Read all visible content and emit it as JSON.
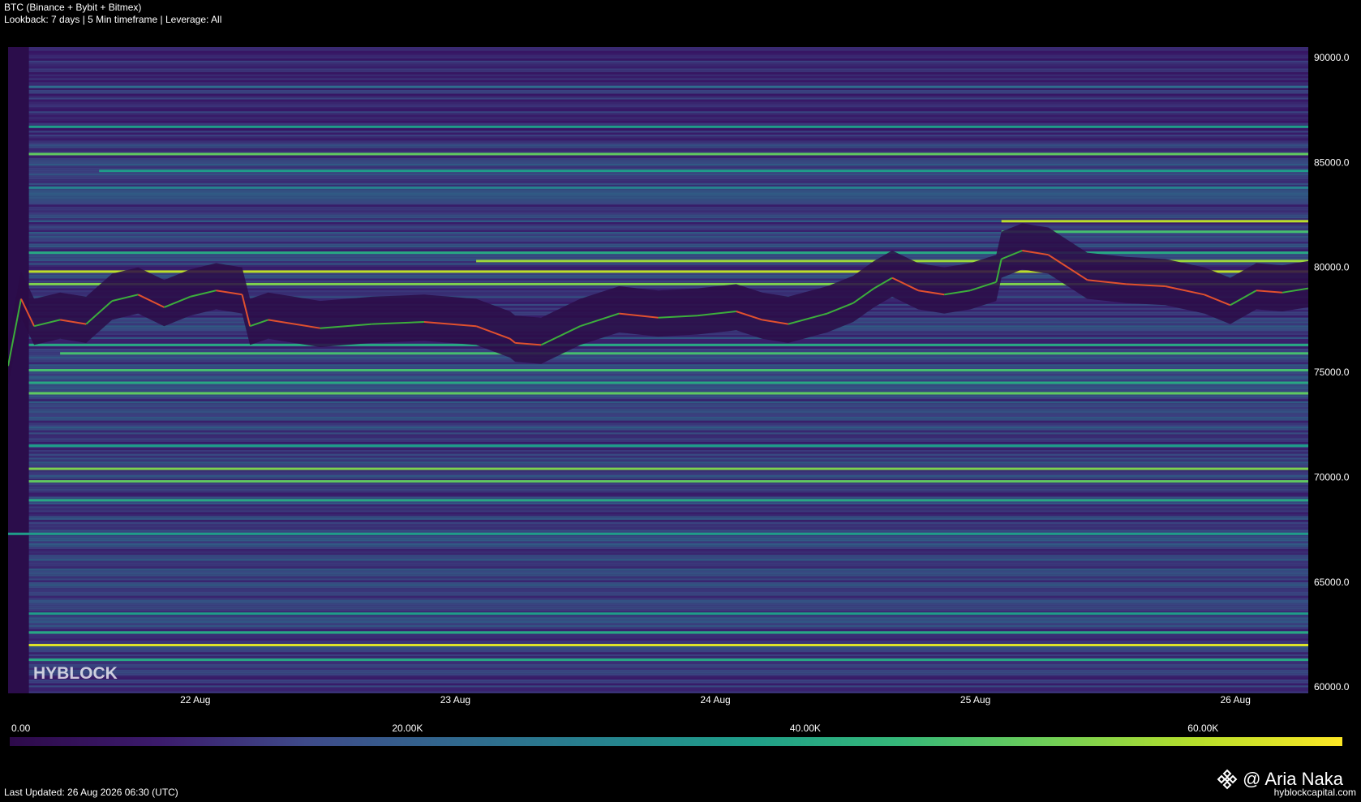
{
  "header": {
    "title": "BTC (Binance + Bybit + Bitmex)",
    "subtitle": "Lookback: 7 days | 5 Min timeframe | Leverage: All"
  },
  "footer": {
    "last_updated": "Last Updated: 26 Aug 2026 06:30 (UTC)",
    "credit": "@ Aria Naka",
    "site": "hyblockcapital.com",
    "credit_icon": "binance-diamond-icon"
  },
  "watermark": "HYBLOCK",
  "chart_data": {
    "type": "heatmap",
    "title": "BTC (Binance + Bybit + Bitmex)",
    "ylim": [
      59700,
      90500
    ],
    "y_ticks": [
      "90000.0",
      "85000.0",
      "80000.0",
      "75000.0",
      "70000.0",
      "65000.0",
      "60000.0"
    ],
    "y_tick_values": [
      90000,
      85000,
      80000,
      75000,
      70000,
      65000,
      60000
    ],
    "x_range_days": [
      0,
      5
    ],
    "x_ticks": [
      "22 Aug",
      "23 Aug",
      "24 Aug",
      "25 Aug",
      "26 Aug"
    ],
    "x_tick_days": [
      0.72,
      1.72,
      2.72,
      3.72,
      4.72
    ],
    "colorbar": {
      "labels": [
        "0.00",
        "20.00K",
        "40.00K",
        "60.00K"
      ],
      "values": [
        0,
        20000,
        40000,
        60000
      ],
      "max": 67000,
      "colors": [
        "#2d0a4a",
        "#3b1a6b",
        "#3e4a89",
        "#31688e",
        "#26828e",
        "#1f9e89",
        "#35b779",
        "#6ece58",
        "#b5de2b",
        "#fde725"
      ]
    },
    "grid": false,
    "price_series": {
      "name": "BTC price",
      "x_days": [
        0,
        0.05,
        0.1,
        0.2,
        0.3,
        0.4,
        0.5,
        0.6,
        0.7,
        0.8,
        0.9,
        0.93,
        1.0,
        1.2,
        1.4,
        1.6,
        1.8,
        1.93,
        1.95,
        2.05,
        2.2,
        2.35,
        2.5,
        2.65,
        2.8,
        2.9,
        3.0,
        3.15,
        3.25,
        3.33,
        3.4,
        3.5,
        3.6,
        3.7,
        3.8,
        3.82,
        3.9,
        4.0,
        4.05,
        4.15,
        4.3,
        4.45,
        4.6,
        4.7,
        4.8,
        4.9,
        5.0
      ],
      "price": [
        75300,
        78500,
        77200,
        77500,
        77300,
        78400,
        78700,
        78100,
        78600,
        78900,
        78700,
        77200,
        77500,
        77100,
        77300,
        77400,
        77200,
        76600,
        76400,
        76300,
        77200,
        77800,
        77600,
        77700,
        77900,
        77500,
        77300,
        77800,
        78300,
        79000,
        79500,
        78900,
        78700,
        78900,
        79300,
        80400,
        80800,
        80600,
        80200,
        79400,
        79200,
        79100,
        78700,
        78200,
        78900,
        78800,
        79000
      ],
      "up_color": "#3cae3c",
      "down_color": "#e0502e"
    },
    "bands_note_levels": [
      {
        "price": 88600,
        "intensity": 0.35,
        "start_day": 0.08
      },
      {
        "price": 86700,
        "intensity": 0.55,
        "start_day": 0.08
      },
      {
        "price": 85400,
        "intensity": 0.75,
        "start_day": 0.08
      },
      {
        "price": 84600,
        "intensity": 0.55,
        "start_day": 0.35
      },
      {
        "price": 83800,
        "intensity": 0.45,
        "start_day": 0.08
      },
      {
        "price": 82200,
        "intensity": 0.9,
        "start_day": 3.82
      },
      {
        "price": 81700,
        "intensity": 0.7,
        "start_day": 3.82
      },
      {
        "price": 80700,
        "intensity": 0.6,
        "start_day": 0.08
      },
      {
        "price": 80300,
        "intensity": 0.85,
        "start_day": 1.8
      },
      {
        "price": 79800,
        "intensity": 0.9,
        "start_day": 0.08
      },
      {
        "price": 79200,
        "intensity": 0.8,
        "start_day": 0.08
      },
      {
        "price": 76300,
        "intensity": 0.6,
        "start_day": 0.08
      },
      {
        "price": 75900,
        "intensity": 0.7,
        "start_day": 0.2
      },
      {
        "price": 75100,
        "intensity": 0.7,
        "start_day": 0.08
      },
      {
        "price": 74500,
        "intensity": 0.6,
        "start_day": 0.08
      },
      {
        "price": 74000,
        "intensity": 0.75,
        "start_day": 0.08
      },
      {
        "price": 71500,
        "intensity": 0.55,
        "start_day": 0.08
      },
      {
        "price": 70400,
        "intensity": 0.8,
        "start_day": 0.08
      },
      {
        "price": 69800,
        "intensity": 0.75,
        "start_day": 0.08
      },
      {
        "price": 68900,
        "intensity": 0.6,
        "start_day": 0.08
      },
      {
        "price": 67300,
        "intensity": 0.55,
        "start_day": 0.0
      },
      {
        "price": 63500,
        "intensity": 0.55,
        "start_day": 0.08
      },
      {
        "price": 62600,
        "intensity": 0.6,
        "start_day": 0.08
      },
      {
        "price": 62000,
        "intensity": 0.95,
        "start_day": 0.08
      },
      {
        "price": 61300,
        "intensity": 0.6,
        "start_day": 0.08
      }
    ]
  }
}
